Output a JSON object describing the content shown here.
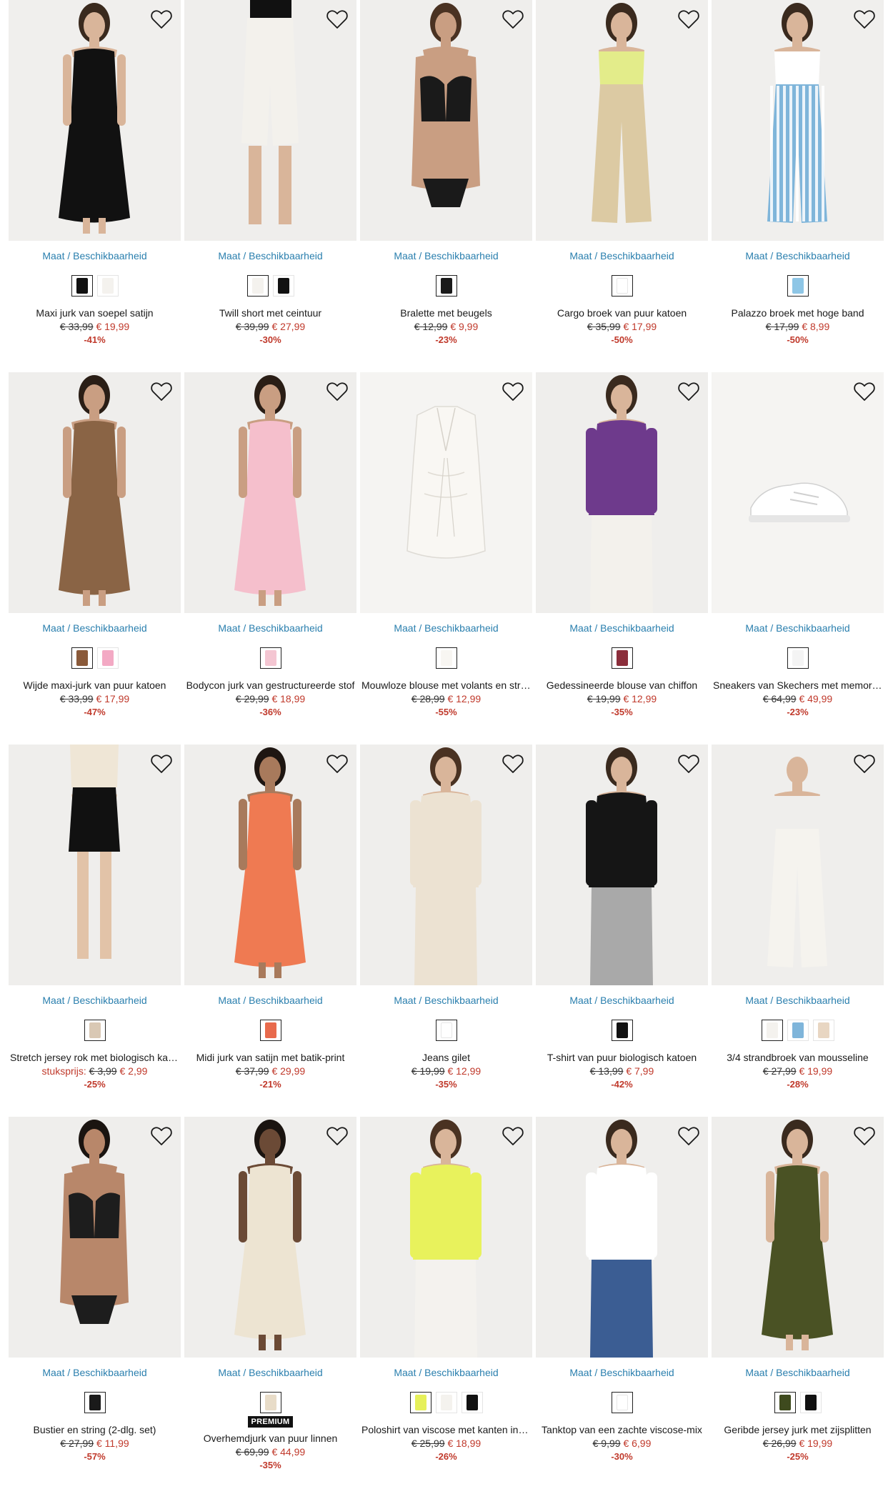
{
  "size_link_label": "Maat / Beschikbaarheid",
  "icons": {
    "wishlist": "heart-outline-icon"
  },
  "colors": {
    "link": "#2a7fae",
    "sale": "#c0392b",
    "badge_bg": "#111111"
  },
  "products": [
    {
      "title": "Maxi jurk van soepel satijn",
      "old_price": "€ 33,99",
      "new_price": "€ 19,99",
      "discount": "-41%",
      "swatches": [
        "#111111",
        "#f4f2ee"
      ],
      "fig": {
        "bg": "#f0efed",
        "top": "#111111",
        "bottom": "#111111",
        "skin": "#d9b59a",
        "hair": "#3a2a1e",
        "shape": "dress"
      }
    },
    {
      "title": "Twill short met ceintuur",
      "old_price": "€ 39,99",
      "new_price": "€ 27,99",
      "discount": "-30%",
      "swatches": [
        "#f4f2ee",
        "#111111"
      ],
      "fig": {
        "bg": "#efeeec",
        "top": "#111111",
        "bottom": "#f3f1ec",
        "skin": "#d9b59a",
        "hair": "#3a2a1e",
        "shape": "shorts"
      }
    },
    {
      "title": "Bralette met beugels",
      "old_price": "€ 12,99",
      "new_price": "€ 9,99",
      "discount": "-23%",
      "swatches": [
        "#1a1a1a"
      ],
      "fig": {
        "bg": "#efeeec",
        "top": "#1a1a1a",
        "bottom": "#1a1a1a",
        "skin": "#c99e82",
        "hair": "#4a3222",
        "shape": "bra"
      }
    },
    {
      "title": "Cargo broek van puur katoen",
      "old_price": "€ 35,99",
      "new_price": "€ 17,99",
      "discount": "-50%",
      "swatches": [
        "#ffffff"
      ],
      "fig": {
        "bg": "#f0efed",
        "top": "#e3ec8a",
        "bottom": "#dccaa3",
        "skin": "#d9b59a",
        "hair": "#3a2a1e",
        "shape": "pants"
      }
    },
    {
      "title": "Palazzo broek met hoge band",
      "old_price": "€ 17,99",
      "new_price": "€ 8,99",
      "discount": "-50%",
      "swatches": [
        "#8ec6e6"
      ],
      "fig": {
        "bg": "#f0efed",
        "top": "#ffffff",
        "bottom": "#7fb5da",
        "skin": "#d9b59a",
        "hair": "#3a2a1e",
        "shape": "stripes"
      }
    },
    {
      "title": "Wijde maxi-jurk van puur katoen",
      "old_price": "€ 33,99",
      "new_price": "€ 17,99",
      "discount": "-47%",
      "swatches": [
        "#8a5a3a",
        "#f3a9c4"
      ],
      "fig": {
        "bg": "#efeeec",
        "top": "#8a6445",
        "bottom": "#8a6445",
        "skin": "#c99e82",
        "hair": "#2a1e16",
        "shape": "dress"
      }
    },
    {
      "title": "Bodycon jurk van gestructureerde stof",
      "old_price": "€ 29,99",
      "new_price": "€ 18,99",
      "discount": "-36%",
      "swatches": [
        "#f4c6d2"
      ],
      "fig": {
        "bg": "#efeeec",
        "top": "#f5bfcc",
        "bottom": "#f5bfcc",
        "skin": "#c99e82",
        "hair": "#2a1e16",
        "shape": "dress"
      }
    },
    {
      "title": "Mouwloze blouse met volants en strikband",
      "old_price": "€ 28,99",
      "new_price": "€ 12,99",
      "discount": "-55%",
      "swatches": [
        "#f8f6f2"
      ],
      "fig": {
        "bg": "#f5f4f2",
        "top": "#f9f7f3",
        "bottom": "#f5f4f2",
        "skin": "#f5f4f2",
        "hair": "#f5f4f2",
        "shape": "garment"
      }
    },
    {
      "title": "Gedessineerde blouse van chiffon",
      "old_price": "€ 19,99",
      "new_price": "€ 12,99",
      "discount": "-35%",
      "swatches": [
        "#8b2e3b"
      ],
      "fig": {
        "bg": "#efeeec",
        "top": "#6e3a8c",
        "bottom": "#f3f1ec",
        "skin": "#d9b59a",
        "hair": "#3a2a1e",
        "shape": "blouse"
      }
    },
    {
      "title": "Sneakers van Skechers met memory foam",
      "old_price": "€ 64,99",
      "new_price": "€ 49,99",
      "discount": "-23%",
      "swatches": [
        "#f4f4f4"
      ],
      "fig": {
        "bg": "#f5f4f2",
        "top": "#ffffff",
        "bottom": "#e6e6e6",
        "skin": "#f5f4f2",
        "hair": "#f5f4f2",
        "shape": "shoe"
      }
    },
    {
      "title": "Stretch jersey rok met biologisch katoen",
      "unit_label": "stuksprijs:",
      "old_price": "€ 3,99",
      "new_price": "€ 2,99",
      "discount": "-25%",
      "swatches": [
        "#d9c8b4"
      ],
      "fig": {
        "bg": "#efeeec",
        "top": "#efe6d6",
        "bottom": "#111111",
        "skin": "#e2c3a8",
        "hair": "#efeeec",
        "shape": "skirt"
      }
    },
    {
      "title": "Midi jurk van satijn met batik-print",
      "old_price": "€ 37,99",
      "new_price": "€ 29,99",
      "discount": "-21%",
      "swatches": [
        "#e86a4c"
      ],
      "fig": {
        "bg": "#efeeec",
        "top": "#ef7a52",
        "bottom": "#e9a3c0",
        "skin": "#a87a5c",
        "hair": "#1e1612",
        "shape": "dress"
      }
    },
    {
      "title": "Jeans gilet",
      "old_price": "€ 19,99",
      "new_price": "€ 12,99",
      "discount": "-35%",
      "swatches": [
        "#ffffff"
      ],
      "fig": {
        "bg": "#efeeec",
        "top": "#ece2d2",
        "bottom": "#ece2d2",
        "skin": "#d9b59a",
        "hair": "#4a3222",
        "shape": "blouse"
      }
    },
    {
      "title": "T-shirt van puur biologisch katoen",
      "old_price": "€ 13,99",
      "new_price": "€ 7,99",
      "discount": "-42%",
      "swatches": [
        "#111111"
      ],
      "fig": {
        "bg": "#efeeec",
        "top": "#151515",
        "bottom": "#a9a9a9",
        "skin": "#d9b59a",
        "hair": "#3a2a1e",
        "shape": "blouse"
      }
    },
    {
      "title": "3/4 strandbroek van mousseline",
      "old_price": "€ 27,99",
      "new_price": "€ 19,99",
      "discount": "-28%",
      "swatches": [
        "#f4f2ee",
        "#7fb5da",
        "#e8d6c2"
      ],
      "fig": {
        "bg": "#efeeec",
        "top": "#efeeec",
        "bottom": "#f5f3ee",
        "skin": "#d9b59a",
        "hair": "#efeeec",
        "shape": "pants"
      }
    },
    {
      "title": "Bustier en string (2-dlg. set)",
      "old_price": "€ 27,99",
      "new_price": "€ 11,99",
      "discount": "-57%",
      "swatches": [
        "#1a1a1a"
      ],
      "fig": {
        "bg": "#efeeec",
        "top": "#1d1d1d",
        "bottom": "#1d1d1d",
        "skin": "#b8876a",
        "hair": "#1a1410",
        "shape": "bra"
      }
    },
    {
      "title": "Overhemdjurk van puur linnen",
      "badge": "PREMIUM",
      "old_price": "€ 69,99",
      "new_price": "€ 44,99",
      "discount": "-35%",
      "swatches": [
        "#e8dcc8"
      ],
      "fig": {
        "bg": "#efeeec",
        "top": "#ede4d2",
        "bottom": "#ede4d2",
        "skin": "#6b4a36",
        "hair": "#1a1410",
        "shape": "dress"
      }
    },
    {
      "title": "Poloshirt van viscose met kanten inzet",
      "old_price": "€ 25,99",
      "new_price": "€ 18,99",
      "discount": "-26%",
      "swatches": [
        "#e6f05a",
        "#f4f2ee",
        "#111111"
      ],
      "fig": {
        "bg": "#efeeec",
        "top": "#e8f25c",
        "bottom": "#f4f2ee",
        "skin": "#d9b59a",
        "hair": "#4a3222",
        "shape": "blouse"
      }
    },
    {
      "title": "Tanktop van een zachte viscose-mix",
      "old_price": "€ 9,99",
      "new_price": "€ 6,99",
      "discount": "-30%",
      "swatches": [
        "#ffffff"
      ],
      "fig": {
        "bg": "#efeeec",
        "top": "#ffffff",
        "bottom": "#3b5d93",
        "skin": "#d9b59a",
        "hair": "#3a2a1e",
        "shape": "blouse"
      }
    },
    {
      "title": "Geribde jersey jurk met zijsplitten",
      "old_price": "€ 26,99",
      "new_price": "€ 19,99",
      "discount": "-25%",
      "swatches": [
        "#3e4a1e",
        "#111111"
      ],
      "fig": {
        "bg": "#efeeec",
        "top": "#4a5224",
        "bottom": "#4a5224",
        "skin": "#d9b59a",
        "hair": "#3a2a1e",
        "shape": "dress"
      }
    }
  ]
}
